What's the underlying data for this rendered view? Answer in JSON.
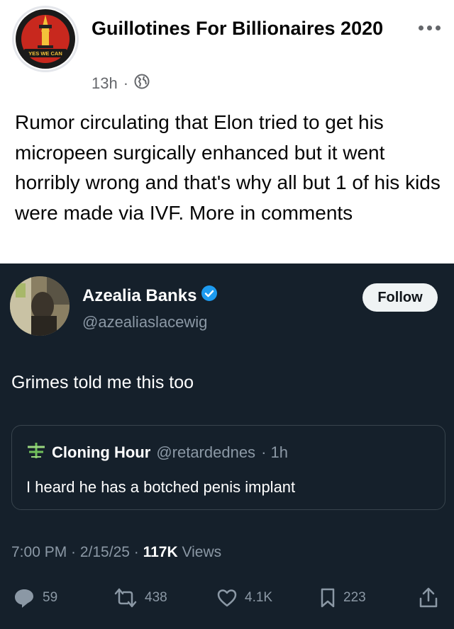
{
  "post": {
    "page_name": "Guillotines For Billionaires 2020",
    "avatar_text": "YES WE CAN",
    "time": "13h",
    "separator": "·",
    "text": "Rumor circulating that Elon tried to get his micropeen surgically enhanced but it went horribly wrong and that's why all but 1 of his kids were made via IVF. More in comments"
  },
  "tweet": {
    "author_name": "Azealia Banks",
    "author_handle": "@azealiaslacewig",
    "follow_label": "Follow",
    "body": "Grimes told me this too",
    "quote": {
      "author_name": "Cloning Hour",
      "author_handle": "@retardednes",
      "time": "· 1h",
      "text": "I heard he has a botched penis implant"
    },
    "timestamp": "7:00 PM · 2/15/25 · ",
    "views_count": "117K",
    "views_label": " Views",
    "actions": {
      "replies": "59",
      "reposts": "438",
      "likes": "4.1K",
      "bookmarks": "223"
    }
  },
  "colors": {
    "tweet_background": "#15202b",
    "verified_badge": "#1d9bf0",
    "meta_gray": "#65676b"
  },
  "icons": [
    "more-icon",
    "globe-icon",
    "verified-icon",
    "reply-icon",
    "repost-icon",
    "like-icon",
    "bookmark-icon",
    "share-icon"
  ]
}
